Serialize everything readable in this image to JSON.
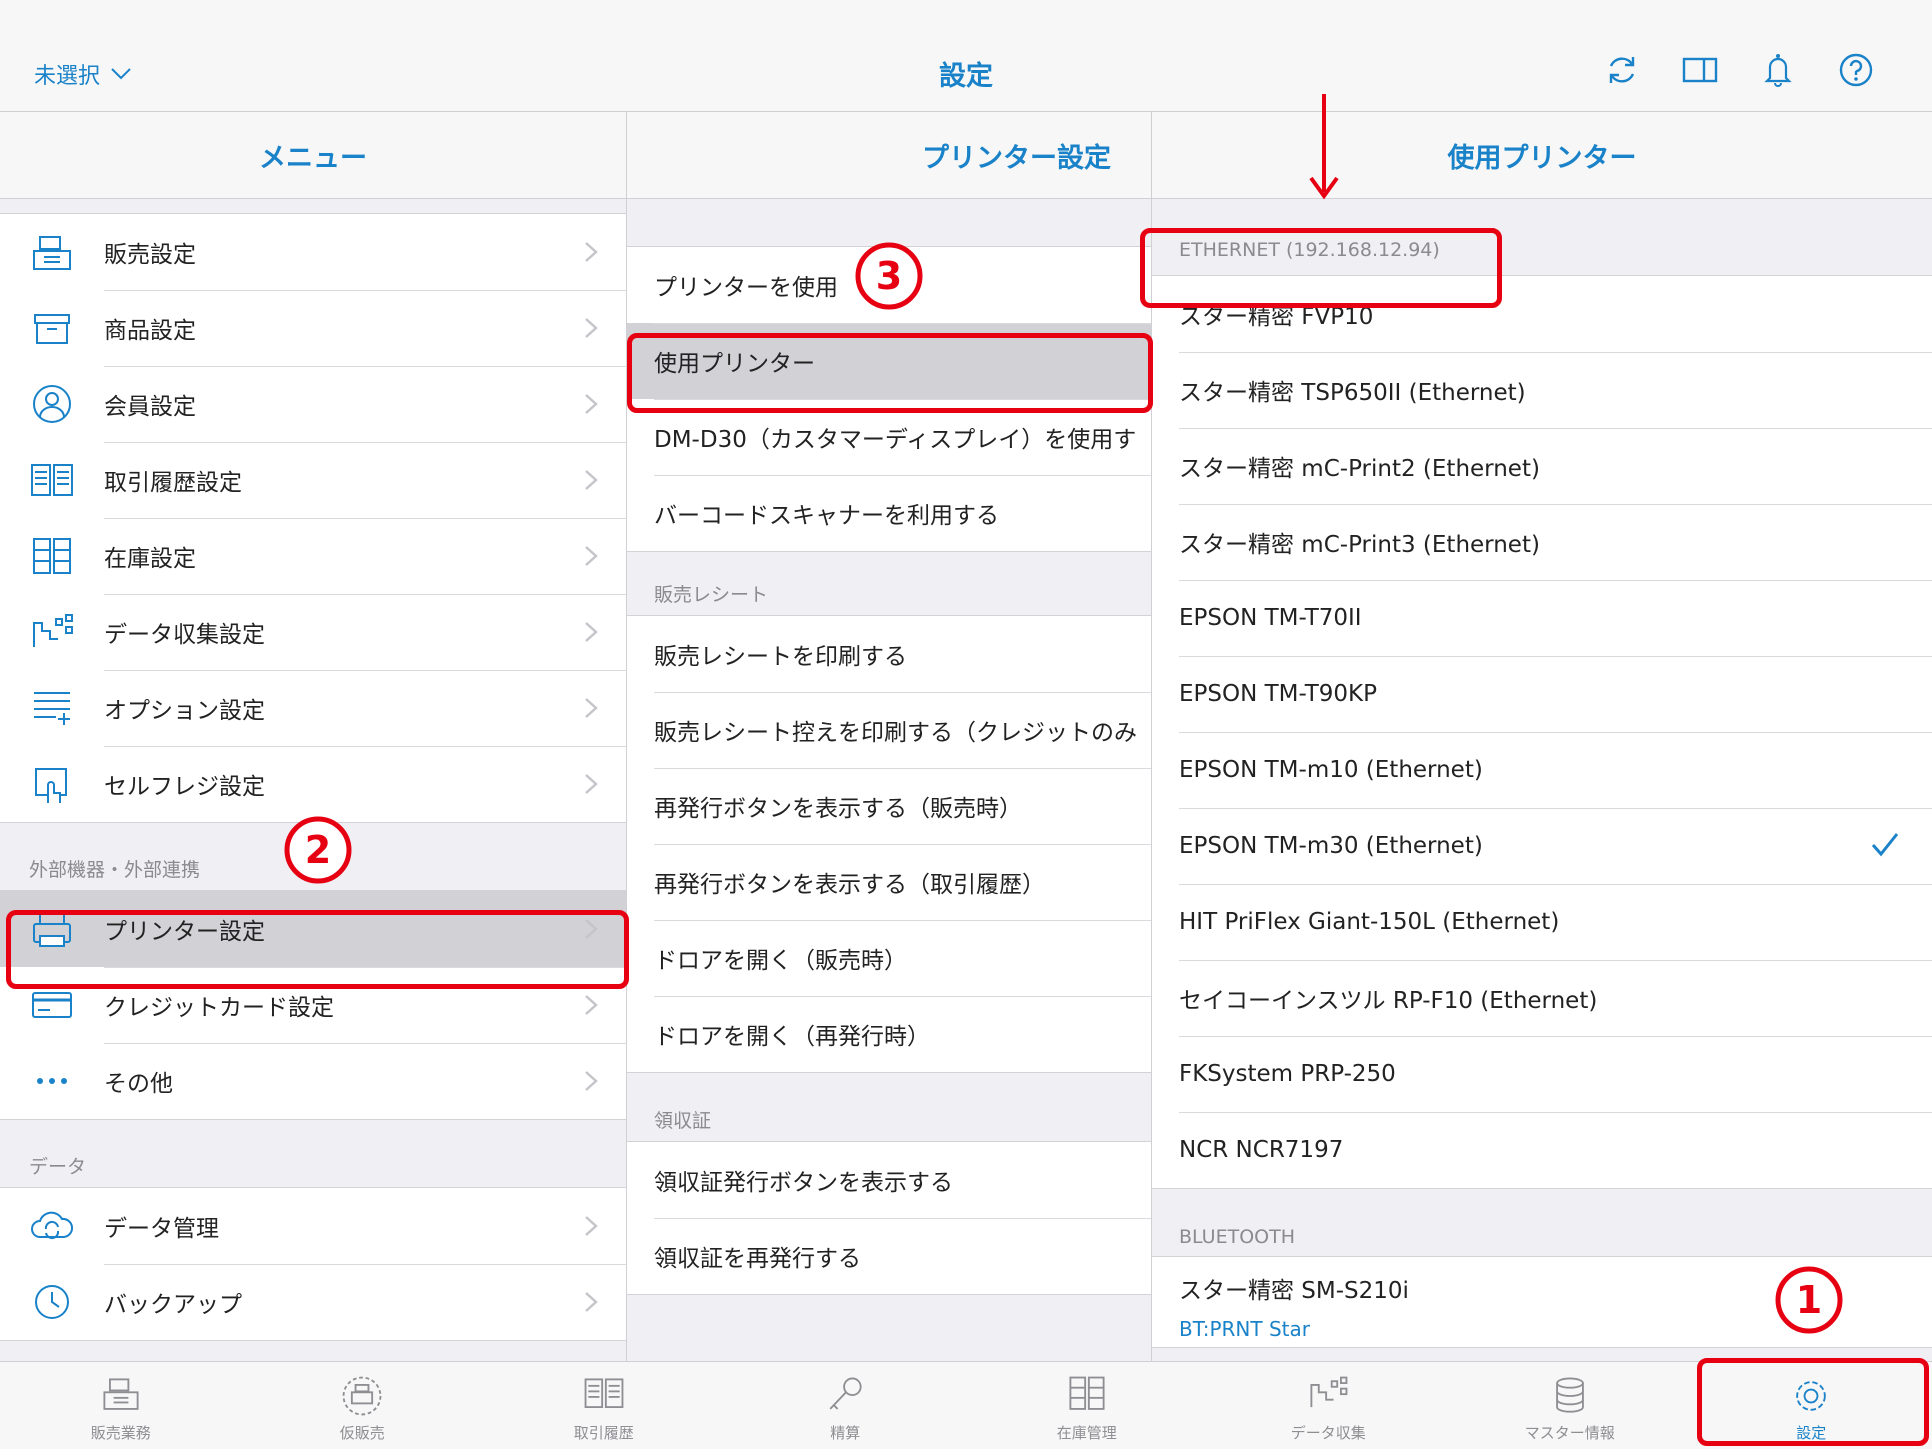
{
  "header": {
    "store_select": "未選択",
    "title": "設定"
  },
  "menu": {
    "title": "メニュー",
    "items_main": [
      {
        "label": "販売設定",
        "icon": "register-icon"
      },
      {
        "label": "商品設定",
        "icon": "box-icon"
      },
      {
        "label": "会員設定",
        "icon": "person-icon"
      },
      {
        "label": "取引履歴設定",
        "icon": "book-icon"
      },
      {
        "label": "在庫設定",
        "icon": "cabinet-icon"
      },
      {
        "label": "データ収集設定",
        "icon": "chart-icon"
      },
      {
        "label": "オプション設定",
        "icon": "list-plus-icon"
      },
      {
        "label": "セルフレジ設定",
        "icon": "touch-icon"
      }
    ],
    "section_external": "外部機器・外部連携",
    "items_external": [
      {
        "label": "プリンター設定",
        "icon": "printer-icon",
        "selected": true
      },
      {
        "label": "クレジットカード設定",
        "icon": "card-icon"
      },
      {
        "label": "その他",
        "icon": "more-icon"
      }
    ],
    "section_data": "データ",
    "items_data": [
      {
        "label": "データ管理",
        "icon": "cloud-sync-icon"
      },
      {
        "label": "バックアップ",
        "icon": "clock-icon"
      }
    ]
  },
  "printer_settings": {
    "title": "プリンター設定",
    "items_top": [
      {
        "label": "プリンターを使用"
      },
      {
        "label": "使用プリンター",
        "selected": true
      },
      {
        "label": "DM-D30（カスタマーディスプレイ）を使用す"
      },
      {
        "label": "バーコードスキャナーを利用する"
      }
    ],
    "section_receipt": "販売レシート",
    "items_receipt": [
      {
        "label": "販売レシートを印刷する"
      },
      {
        "label": "販売レシート控えを印刷する（クレジットのみ"
      },
      {
        "label": "再発行ボタンを表示する（販売時）"
      },
      {
        "label": "再発行ボタンを表示する（取引履歴）"
      },
      {
        "label": "ドロアを開く（販売時）"
      },
      {
        "label": "ドロアを開く（再発行時）"
      }
    ],
    "section_invoice": "領収証",
    "items_invoice": [
      {
        "label": "領収証発行ボタンを表示する"
      },
      {
        "label": "領収証を再発行する"
      }
    ]
  },
  "use_printer": {
    "title": "使用プリンター",
    "section_ethernet": "ETHERNET (192.168.12.94)",
    "ethernet_printers": [
      {
        "label": "スター精密 FVP10"
      },
      {
        "label": "スター精密 TSP650II (Ethernet)"
      },
      {
        "label": "スター精密 mC-Print2 (Ethernet)"
      },
      {
        "label": "スター精密 mC-Print3 (Ethernet)"
      },
      {
        "label": "EPSON TM-T70II"
      },
      {
        "label": "EPSON TM-T90KP"
      },
      {
        "label": "EPSON TM-m10 (Ethernet)"
      },
      {
        "label": "EPSON TM-m30 (Ethernet)",
        "checked": true
      },
      {
        "label": "HIT PriFlex Giant-150L (Ethernet)"
      },
      {
        "label": "セイコーインスツル RP-F10 (Ethernet)"
      },
      {
        "label": "FKSystem PRP-250"
      },
      {
        "label": "NCR NCR7197"
      }
    ],
    "section_bluetooth": "BLUETOOTH",
    "bluetooth_printer": {
      "label": "スター精密 SM-S210i",
      "sub": "BT:PRNT Star"
    }
  },
  "tabbar": [
    {
      "label": "販売業務",
      "icon": "register-icon"
    },
    {
      "label": "仮販売",
      "icon": "temp-register-icon"
    },
    {
      "label": "取引履歴",
      "icon": "book-icon"
    },
    {
      "label": "精算",
      "icon": "key-icon"
    },
    {
      "label": "在庫管理",
      "icon": "cabinet-icon"
    },
    {
      "label": "データ収集",
      "icon": "chart-icon"
    },
    {
      "label": "マスター情報",
      "icon": "database-icon"
    },
    {
      "label": "設定",
      "icon": "gear-icon",
      "active": true
    }
  ],
  "annotations": {
    "step1": "①",
    "step2": "②",
    "step3": "③"
  },
  "colors": {
    "accent": "#1a82c8",
    "annotation": "#e60012",
    "selected_row": "#d1d1d6",
    "grouped_bg": "#efeff4"
  }
}
